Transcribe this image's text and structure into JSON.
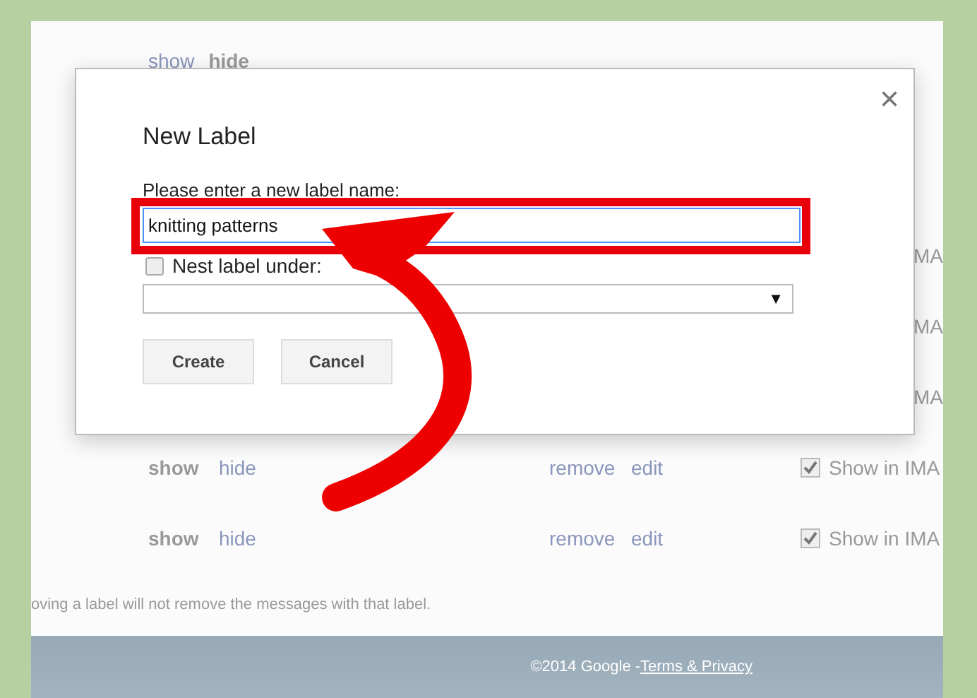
{
  "background": {
    "top_row": {
      "show": "show",
      "hide": "hide",
      "shown": false
    },
    "covered_rows": [
      "MA",
      "MA",
      "MA"
    ],
    "rows": [
      {
        "show": "show",
        "hide": "hide",
        "shown": true,
        "remove": "remove",
        "edit": "edit",
        "imap_checked": true,
        "imap_label": "Show in IMA"
      },
      {
        "show": "show",
        "hide": "hide",
        "shown": true,
        "remove": "remove",
        "edit": "edit",
        "imap_checked": true,
        "imap_label": "Show in IMA"
      }
    ],
    "note": "oving a label will not remove the messages with that label.",
    "footer": {
      "copyright": "©2014 Google - ",
      "link": "Terms & Privacy"
    }
  },
  "dialog": {
    "title": "New Label",
    "close": "×",
    "prompt": "Please enter a new label name:",
    "value": "knitting patterns",
    "nest": {
      "label": "Nest label under:",
      "checked": false
    },
    "select_arrow": "▼",
    "buttons": [
      "Create",
      "Cancel"
    ]
  }
}
